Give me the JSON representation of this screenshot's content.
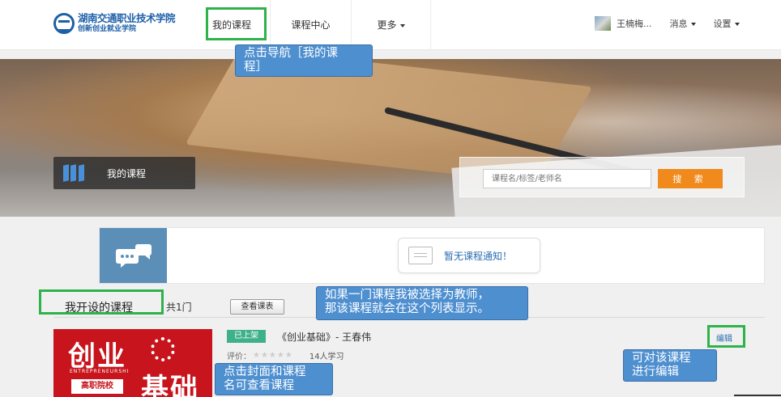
{
  "header": {
    "logo": {
      "line1": "湖南交通职业技术学院",
      "line2": "创新创业就业学院"
    },
    "nav": [
      {
        "label": "我的课程"
      },
      {
        "label": "课程中心"
      },
      {
        "label": "更多"
      }
    ],
    "user": {
      "name": "王楠梅...",
      "messages": "消息",
      "settings": "设置"
    }
  },
  "banner": {
    "tag_label": "我的课程",
    "search": {
      "placeholder": "课程名/标签/老师名",
      "button": "搜 索"
    }
  },
  "notice": {
    "message": "暂无课程通知！"
  },
  "section": {
    "title": "我开设的课程",
    "count": "共1门",
    "schedule_button": "查看课表"
  },
  "course": {
    "cover": {
      "big1": "创业",
      "english": "ENTREPRENEURSHI",
      "badge": "高职院校",
      "big2": "基础"
    },
    "status": "已上架",
    "name": "《创业基础》- 王春伟",
    "rating_label": "评价：",
    "stars": "★★★★★",
    "learners": "14人学习",
    "edit": "编辑"
  },
  "annotations": [
    {
      "text": "点击导航［我的课\n程］"
    },
    {
      "text": "如果一门课程我被选择为教师，\n那该课程就会在这个列表显示。"
    },
    {
      "text": "点击封面和课程\n名可查看课程"
    },
    {
      "text": "可对该课程\n进行编辑"
    }
  ],
  "colors": {
    "accent_green": "#2fb24a",
    "callout_blue": "#4e8fd0",
    "search_orange": "#f08a1c",
    "status_green": "#3eb18b"
  }
}
